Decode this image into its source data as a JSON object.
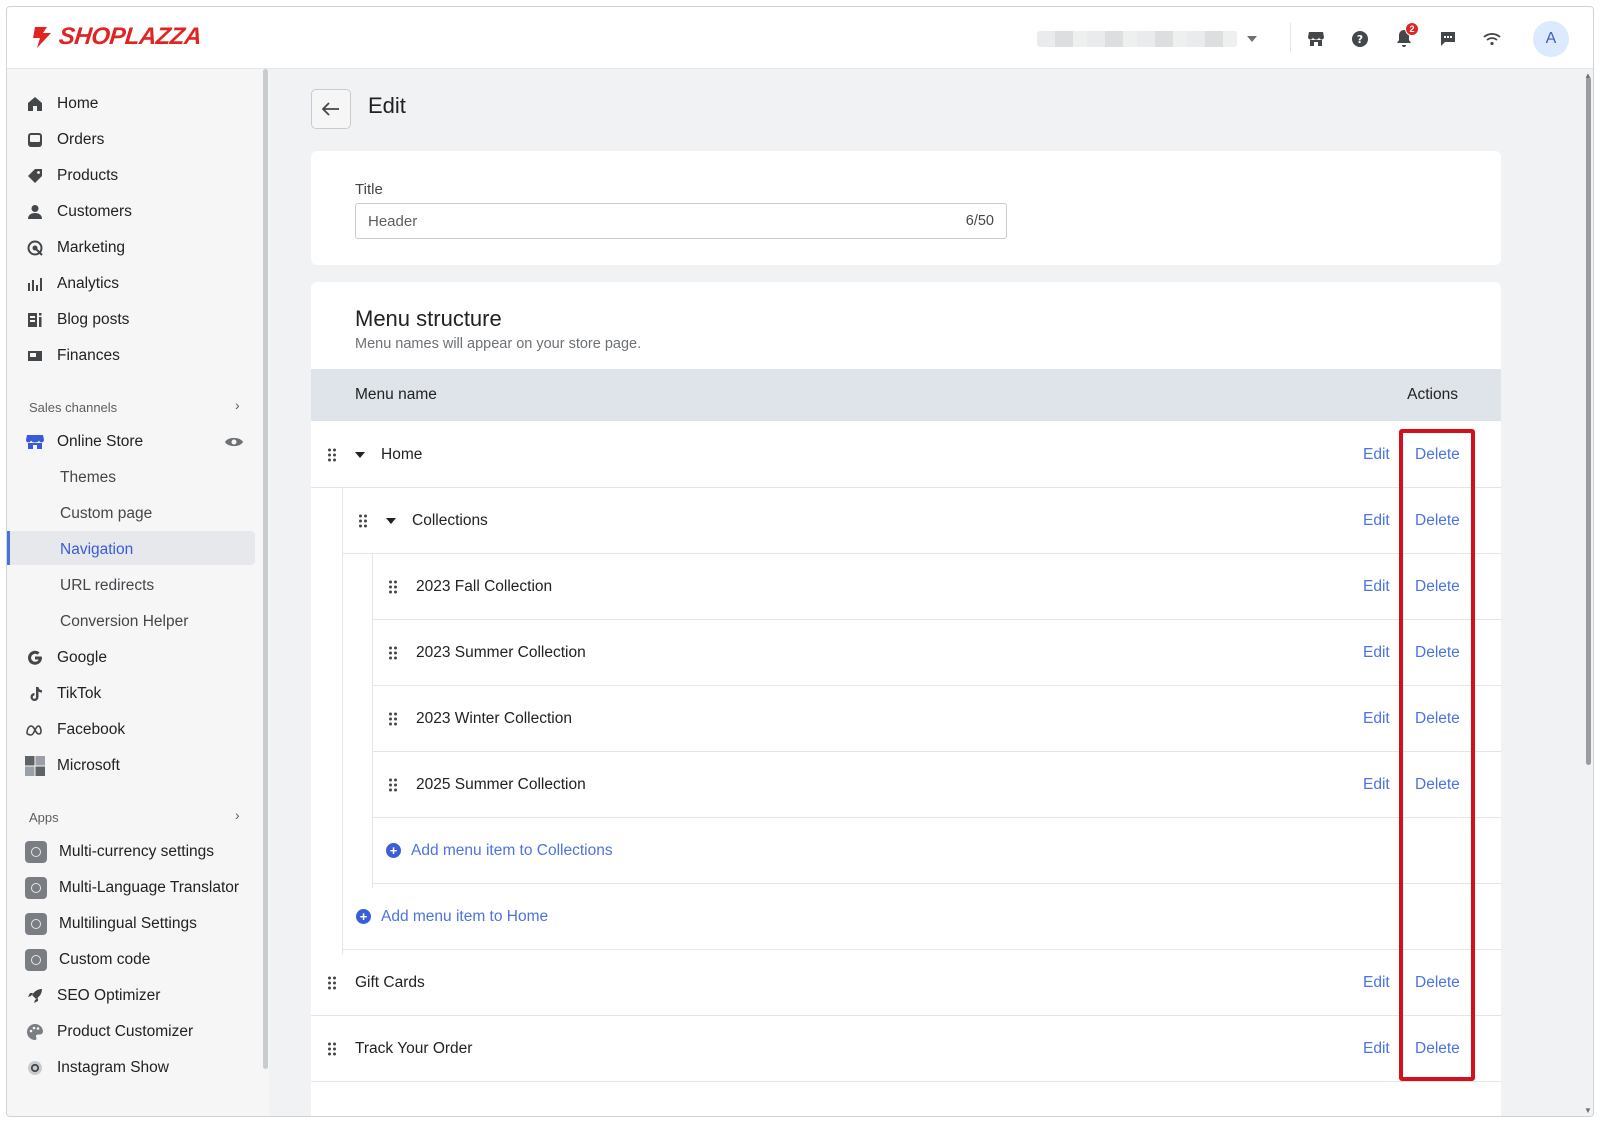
{
  "brand": {
    "name": "SHOPLAZZA",
    "color": "#e02424"
  },
  "topbar": {
    "notification_count": "2",
    "avatar_initial": "A"
  },
  "sidebar": {
    "main_items": [
      {
        "label": "Home",
        "icon": "home-icon"
      },
      {
        "label": "Orders",
        "icon": "inbox-icon"
      },
      {
        "label": "Products",
        "icon": "tag-icon"
      },
      {
        "label": "Customers",
        "icon": "person-icon"
      },
      {
        "label": "Marketing",
        "icon": "target-icon"
      },
      {
        "label": "Analytics",
        "icon": "bar-chart-icon"
      },
      {
        "label": "Blog posts",
        "icon": "blog-icon"
      },
      {
        "label": "Finances",
        "icon": "finance-icon"
      }
    ],
    "sales_channels_label": "Sales channels",
    "online_store": {
      "label": "Online Store",
      "sub_items": [
        "Themes",
        "Custom page",
        "Navigation",
        "URL redirects",
        "Conversion Helper"
      ],
      "active": "Navigation"
    },
    "channels": [
      {
        "label": "Google",
        "icon": "google-icon"
      },
      {
        "label": "TikTok",
        "icon": "tiktok-icon"
      },
      {
        "label": "Facebook",
        "icon": "meta-icon"
      },
      {
        "label": "Microsoft",
        "icon": "microsoft-icon"
      }
    ],
    "apps_label": "Apps",
    "apps": [
      {
        "label": "Multi-currency settings"
      },
      {
        "label": "Multi-Language Translator"
      },
      {
        "label": "Multilingual Settings"
      },
      {
        "label": "Custom code"
      },
      {
        "label": "SEO Optimizer"
      },
      {
        "label": "Product Customizer"
      },
      {
        "label": "Instagram Show"
      }
    ]
  },
  "page": {
    "title": "Edit",
    "title_field": {
      "label": "Title",
      "value": "Header",
      "counter": "6/50"
    },
    "menu": {
      "heading": "Menu structure",
      "subheading": "Menu names will appear on your store page.",
      "col_name": "Menu name",
      "col_actions": "Actions",
      "edit_label": "Edit",
      "delete_label": "Delete",
      "rows": [
        {
          "name": "Home",
          "level": 0,
          "expandable": true
        },
        {
          "name": "Collections",
          "level": 1,
          "expandable": true
        },
        {
          "name": "2023 Fall Collection",
          "level": 2
        },
        {
          "name": "2023 Summer Collection",
          "level": 2
        },
        {
          "name": "2023 Winter Collection",
          "level": 2
        },
        {
          "name": "2025 Summer Collection",
          "level": 2
        }
      ],
      "add_to_collections": "Add menu item to Collections",
      "add_to_home": "Add menu item to Home",
      "bottom_rows": [
        {
          "name": "Gift Cards",
          "level": 0
        },
        {
          "name": "Track Your Order",
          "level": 0
        }
      ],
      "link_color": "#4c73e0",
      "highlight_color": "#d3101b"
    }
  }
}
